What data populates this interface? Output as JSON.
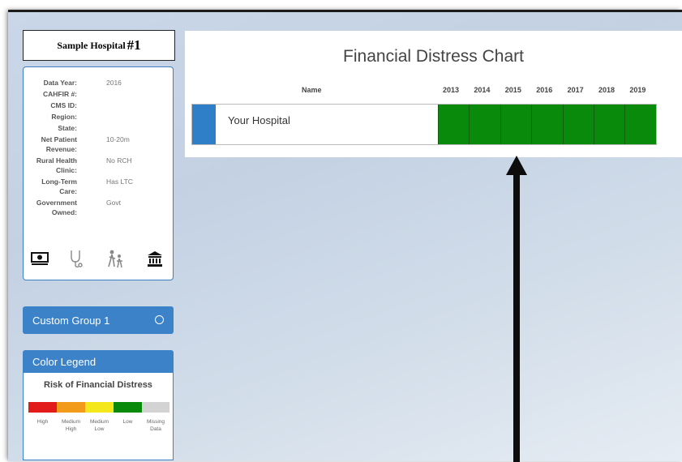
{
  "sidebar": {
    "hospital_title_a": "Sample Hospital",
    "hospital_title_b": "#1",
    "info": [
      {
        "label": "Data Year:",
        "value": "2016"
      },
      {
        "label": "CAHFIR #:",
        "value": ""
      },
      {
        "label": "CMS ID:",
        "value": ""
      },
      {
        "label": "Region:",
        "value": ""
      },
      {
        "label": "State:",
        "value": ""
      },
      {
        "label": "Net Patient",
        "label2": "Revenue:",
        "value": "10-20m"
      },
      {
        "label": "Rural Health",
        "label2": "Clinic:",
        "value": "No RCH"
      },
      {
        "label": "Long-Term",
        "label2": "Care:",
        "value": "Has LTC"
      },
      {
        "label": "Government",
        "label2": "Owned:",
        "value": "Govt"
      }
    ],
    "icons": [
      "money-icon",
      "stethoscope-icon",
      "people-icon",
      "government-building-icon"
    ],
    "custom_group_label": "Custom Group 1",
    "legend": {
      "header": "Color Legend",
      "title": "Risk of Financial Distress",
      "items": [
        {
          "label": "High",
          "label2": "",
          "color": "#e21b1b"
        },
        {
          "label": "Medium",
          "label2": "High",
          "color": "#f29a1a"
        },
        {
          "label": "Medium",
          "label2": "Low",
          "color": "#f4e81c"
        },
        {
          "label": "Low",
          "label2": "",
          "color": "#0a8a0a"
        },
        {
          "label": "Missing",
          "label2": "Data",
          "color": "#d3d3d3"
        }
      ]
    }
  },
  "chart": {
    "title": "Financial Distress Chart",
    "name_header": "Name",
    "years": [
      "2013",
      "2014",
      "2015",
      "2016",
      "2017",
      "2018",
      "2019"
    ],
    "rows": [
      {
        "name": "Your Hospital",
        "statuses": [
          "Low",
          "Low",
          "Low",
          "Low",
          "Low",
          "Low",
          "Low"
        ]
      }
    ]
  },
  "colors": {
    "accent": "#3b82c8",
    "low_risk": "#0a8a0a"
  }
}
